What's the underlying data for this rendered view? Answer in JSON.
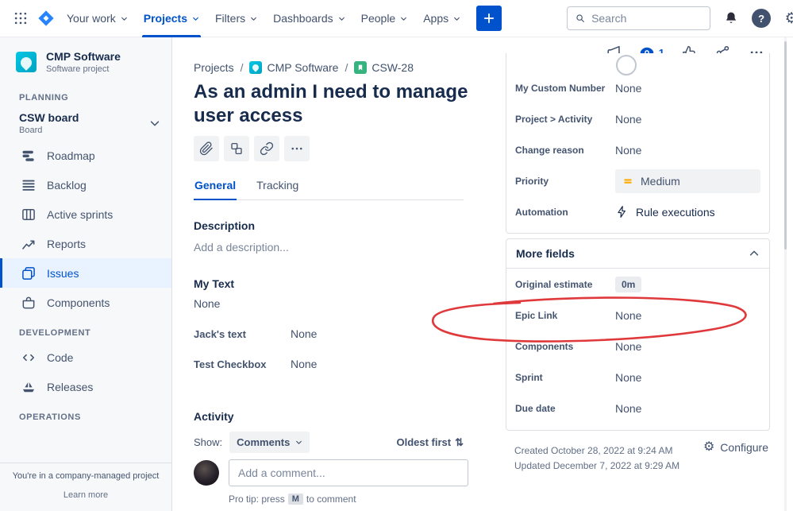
{
  "colors": {
    "brand_blue": "#0052CC",
    "selected_bg": "#E9F2FF",
    "priority_medium_orange": "#FFAB00",
    "issue_type_green": "#36B37E",
    "project_teal": "#00B8D9",
    "annotation_red": "#E0393C"
  },
  "icons": {
    "gear": "⚙",
    "sort": "⇅"
  },
  "topnav": {
    "items": [
      {
        "label": "Your work"
      },
      {
        "label": "Projects"
      },
      {
        "label": "Filters"
      },
      {
        "label": "Dashboards"
      },
      {
        "label": "People"
      },
      {
        "label": "Apps"
      }
    ],
    "search_placeholder": "Search"
  },
  "sidebar": {
    "project_name": "CMP Software",
    "project_type": "Software project",
    "planning_label": "PLANNING",
    "board_name": "CSW board",
    "board_type": "Board",
    "planning_items": [
      {
        "label": "Roadmap"
      },
      {
        "label": "Backlog"
      },
      {
        "label": "Active sprints"
      },
      {
        "label": "Reports"
      },
      {
        "label": "Issues"
      },
      {
        "label": "Components"
      }
    ],
    "development_label": "DEVELOPMENT",
    "development_items": [
      {
        "label": "Code"
      },
      {
        "label": "Releases"
      }
    ],
    "operations_label": "OPERATIONS",
    "footer_note": "You're in a company-managed project",
    "learn_more": "Learn more"
  },
  "breadcrumb": {
    "projects": "Projects",
    "separator": "/",
    "project": "CMP Software",
    "issue_key": "CSW-28"
  },
  "issue": {
    "title": "As an admin I need to manage user access",
    "tabs": [
      {
        "label": "General"
      },
      {
        "label": "Tracking"
      }
    ],
    "description_label": "Description",
    "description_placeholder": "Add a description...",
    "my_text_label": "My Text",
    "my_text_value": "None",
    "fields": [
      {
        "label": "Jack's text",
        "value": "None"
      },
      {
        "label": "Test Checkbox",
        "value": "None"
      }
    ],
    "activity": {
      "title": "Activity",
      "show_label": "Show:",
      "filter": "Comments",
      "sort": "Oldest first",
      "comment_placeholder": "Add a comment...",
      "pro_tip_prefix": "Pro tip: press",
      "pro_tip_key": "M",
      "pro_tip_suffix": "to comment"
    }
  },
  "details": {
    "watch_count": "1",
    "pinned_fields": [
      {
        "label": "My Custom Number",
        "value": "None"
      },
      {
        "label": "Project > Activity",
        "value": "None"
      },
      {
        "label": "Change reason",
        "value": "None"
      },
      {
        "label": "Priority",
        "value": "Medium"
      },
      {
        "label": "Automation",
        "value": "Rule executions"
      }
    ],
    "more_fields": {
      "title": "More fields",
      "rows": [
        {
          "label": "Original estimate",
          "value": "0m"
        },
        {
          "label": "Epic Link",
          "value": "None"
        },
        {
          "label": "Components",
          "value": "None"
        },
        {
          "label": "Sprint",
          "value": "None"
        },
        {
          "label": "Due date",
          "value": "None"
        }
      ]
    },
    "created": "Created October 28, 2022 at 9:24 AM",
    "updated": "Updated December 7, 2022 at 9:29 AM",
    "configure_label": "Configure"
  }
}
